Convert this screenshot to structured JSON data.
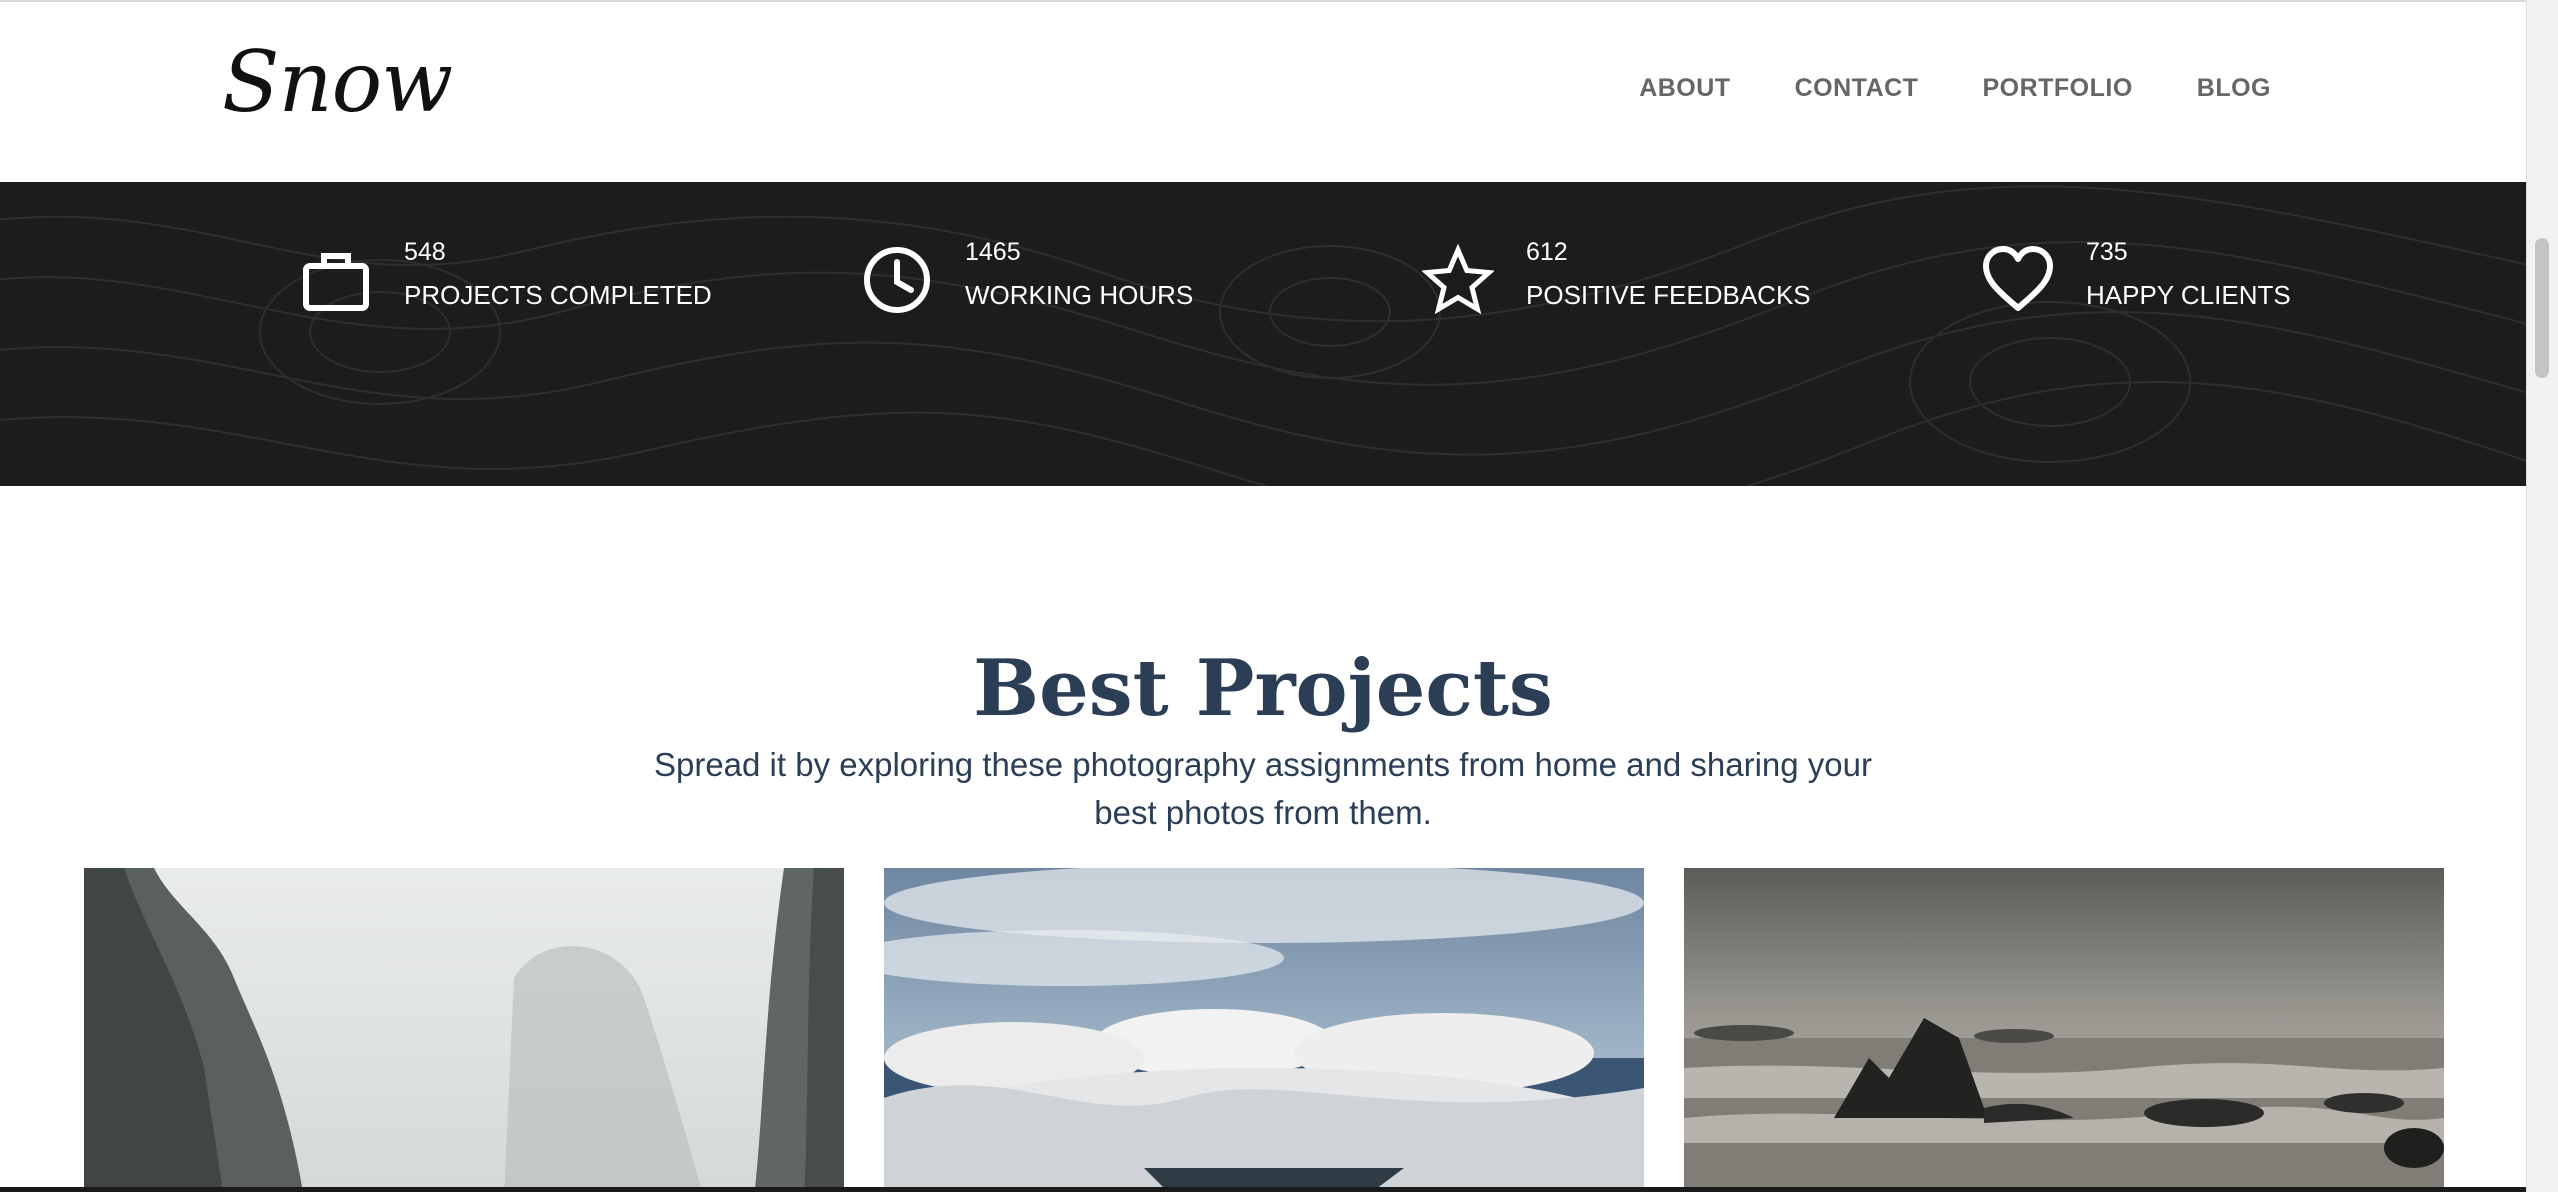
{
  "header": {
    "logo": "Snow",
    "nav": [
      {
        "label": "ABOUT"
      },
      {
        "label": "CONTACT"
      },
      {
        "label": "PORTFOLIO"
      },
      {
        "label": "BLOG"
      }
    ]
  },
  "stats": [
    {
      "icon": "briefcase-icon",
      "value": "548",
      "label": "PROJECTS COMPLETED"
    },
    {
      "icon": "clock-icon",
      "value": "1465",
      "label": "WORKING HOURS"
    },
    {
      "icon": "star-icon",
      "value": "612",
      "label": "POSITIVE FEEDBACKS"
    },
    {
      "icon": "heart-icon",
      "value": "735",
      "label": "HAPPY CLIENTS"
    }
  ],
  "projects": {
    "title": "Best Projects",
    "subtitle": "Spread it by exploring these photography assignments from home and sharing your best photos from them.",
    "items": [
      {
        "image": "misty-cliffs-photo"
      },
      {
        "image": "clouds-sky-photo"
      },
      {
        "image": "rocky-sea-photo"
      }
    ]
  },
  "colors": {
    "stats_bg": "#1c1c1c",
    "heading": "#2c3e55",
    "nav": "#666666"
  }
}
